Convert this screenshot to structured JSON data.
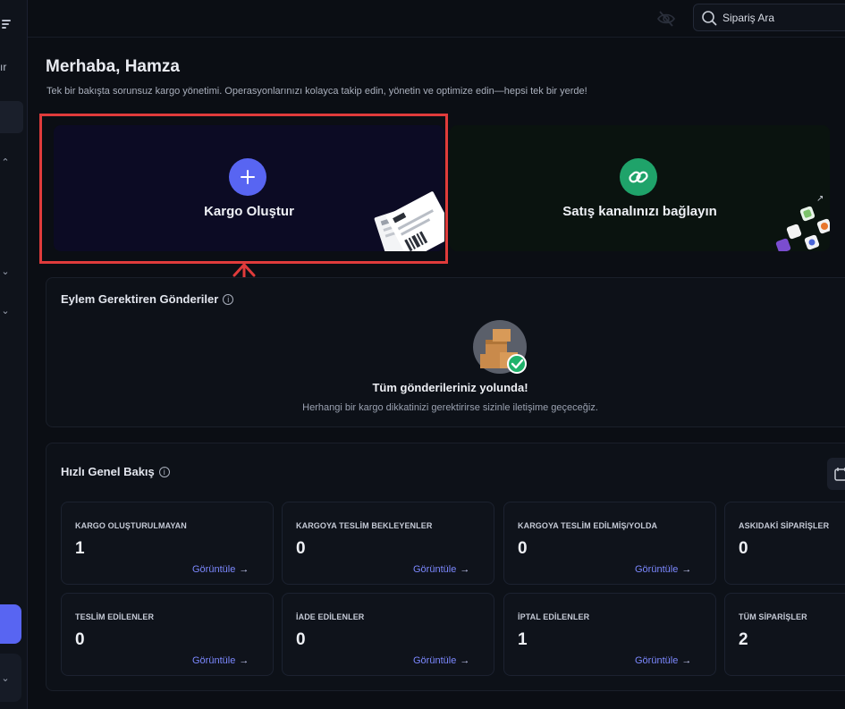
{
  "sidebar": {
    "partial_text": "ır"
  },
  "topbar": {
    "search_placeholder": "Sipariş Ara",
    "icons": [
      "eye-off-icon",
      "search-icon"
    ]
  },
  "header": {
    "greeting": "Merhaba, Hamza",
    "subtitle": "Tek bir bakışta sorunsuz kargo yönetimi. Operasyonlarınızı kolayca takip edin, yönetin ve optimize edin—hepsi tek bir yerde!"
  },
  "actions": {
    "create_label": "Kargo Oluştur",
    "connect_label": "Satış kanalınızı bağlayın"
  },
  "colors": {
    "accent": "#5865f2",
    "green": "#1fa36a",
    "highlight": "#e03b3b",
    "link": "#7c88ff"
  },
  "action_required": {
    "title": "Eylem Gerektiren Gönderiler",
    "empty_title": "Tüm gönderileriniz yolunda!",
    "empty_text": "Herhangi bir kargo dikkatinizi gerektirirse sizinle iletişime geçeceğiz."
  },
  "overview": {
    "title": "Hızlı Genel Bakış",
    "link_label": "Görüntüle",
    "tiles": [
      {
        "label": "KARGO OLUŞTURULMAYAN",
        "value": "1"
      },
      {
        "label": "KARGOYA TESLİM BEKLEYENLER",
        "value": "0"
      },
      {
        "label": "KARGOYA TESLİM EDİLMİŞ/YOLDA",
        "value": "0"
      },
      {
        "label": "ASKIDAKİ SİPARİŞLER",
        "value": "0"
      },
      {
        "label": "TESLİM EDİLENLER",
        "value": "0"
      },
      {
        "label": "İADE EDİLENLER",
        "value": "0"
      },
      {
        "label": "İPTAL EDİLENLER",
        "value": "1"
      },
      {
        "label": "TÜM SİPARİŞLER",
        "value": "2"
      }
    ]
  }
}
